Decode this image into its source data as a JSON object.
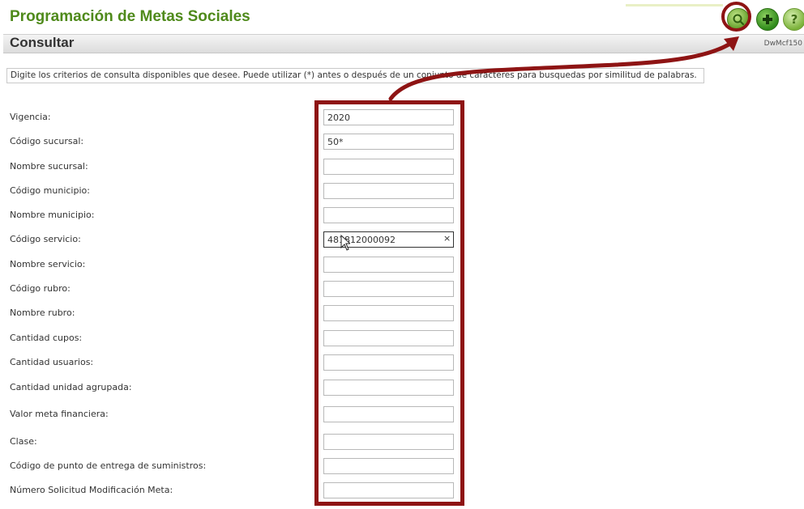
{
  "app": {
    "title": "Programación de Metas Sociales"
  },
  "toolbar": {
    "search_icon": "search-icon",
    "add_icon": "plus-icon",
    "help_icon": "help-icon",
    "help_glyph": "?"
  },
  "section": {
    "title": "Consultar",
    "screen_code": "DwMcf150"
  },
  "instructions": "Digite los criterios de consulta disponibles que desee. Puede utilizar (*) antes o después de un conjunto de caracteres para busquedas por similitud de palabras.",
  "fields": [
    {
      "label": "Vigencia:",
      "value": "2020"
    },
    {
      "label": "Código sucursal:",
      "value": "50*"
    },
    {
      "label": "Nombre sucursal:",
      "value": ""
    },
    {
      "label": "Código municipio:",
      "value": ""
    },
    {
      "label": "Nombre municipio:",
      "value": ""
    },
    {
      "label": "Código servicio:",
      "value": "481812000092",
      "clear": "×"
    },
    {
      "label": "Nombre servicio:",
      "value": ""
    },
    {
      "label": "Código rubro:",
      "value": ""
    },
    {
      "label": "Nombre rubro:",
      "value": ""
    },
    {
      "label": "Cantidad cupos:",
      "value": ""
    },
    {
      "label": "Cantidad usuarios:",
      "value": ""
    },
    {
      "label": "Cantidad unidad agrupada:",
      "value": ""
    },
    {
      "label": "Valor meta financiera:",
      "value": ""
    },
    {
      "label": "Clase:",
      "value": ""
    },
    {
      "label": "Código de punto de entrega de suministros:",
      "value": ""
    },
    {
      "label": "Número Solicitud Modificación Meta:",
      "value": ""
    }
  ],
  "colors": {
    "brand_green": "#4f8a1b",
    "annotation_red": "#8e1414"
  }
}
